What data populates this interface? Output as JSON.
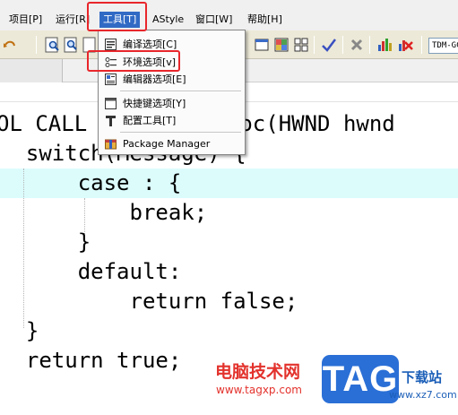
{
  "menubar": {
    "items": [
      {
        "label": "项目[P]"
      },
      {
        "label": "运行[R]"
      },
      {
        "label": "工具[T]"
      },
      {
        "label": "AStyle"
      },
      {
        "label": "窗口[W]"
      },
      {
        "label": "帮助[H]"
      }
    ]
  },
  "toolbar": {
    "build_config": "TDM-GCC"
  },
  "tools_menu": {
    "items": [
      {
        "label": "编译选项[C]",
        "icon": "compiler-options-icon"
      },
      {
        "label": "环境选项[v]",
        "icon": "environment-options-icon"
      },
      {
        "label": "编辑器选项[E]",
        "icon": "editor-options-icon"
      },
      {
        "label": "快捷键选项[Y]",
        "icon": "shortcut-options-icon"
      },
      {
        "label": "配置工具[T]",
        "icon": "configure-tools-icon"
      },
      {
        "label": "Package Manager",
        "icon": "package-manager-icon"
      }
    ]
  },
  "editor": {
    "lines": [
      "OL CALL",
      "dProc(HWND hwnd",
      "  switch(Message) {",
      "      case : {",
      "          break;",
      "      }",
      "      default:",
      "          return false;",
      "  }",
      "  return true;"
    ]
  },
  "watermark": {
    "site_name": "电脑技术网",
    "site_url": "www.tagxp.com",
    "logo_text": "TAG",
    "side_text": "下载站",
    "side_url": "www.xz7.com"
  },
  "colors": {
    "highlight_red": "#e8262b",
    "menu_active": "#316ac5",
    "current_line": "#dcfcfc",
    "tag_blue": "#2a6fd6"
  }
}
